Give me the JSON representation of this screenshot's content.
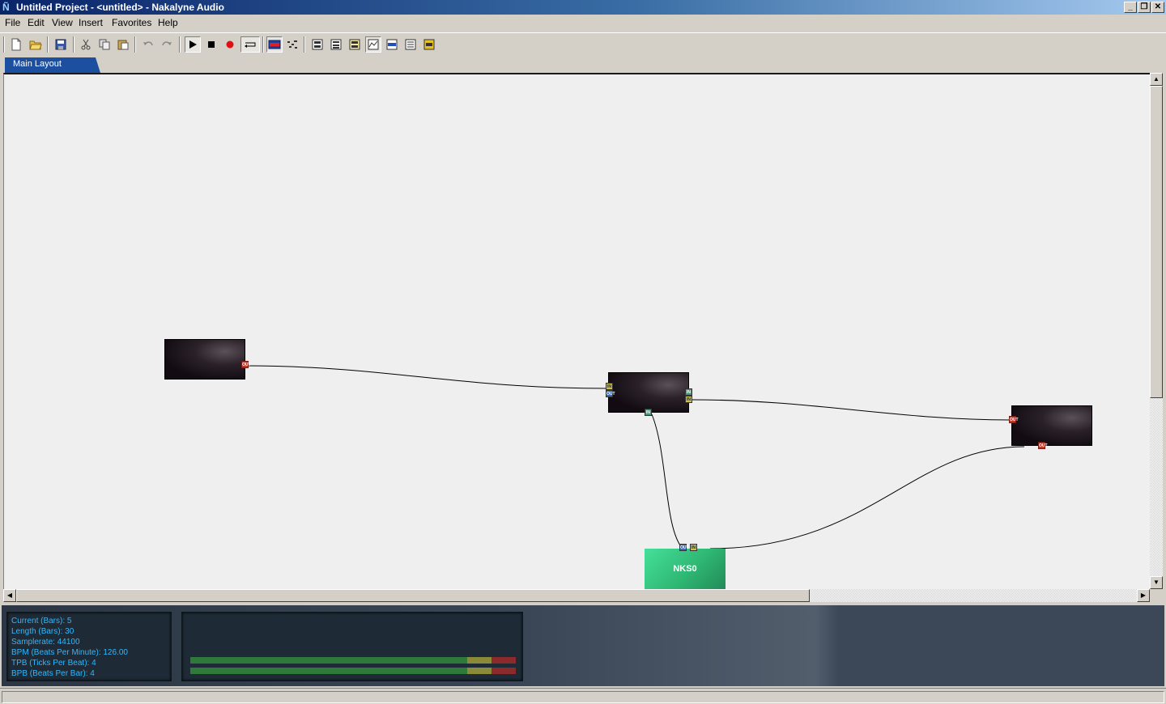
{
  "window": {
    "title": "Untitled Project - <untitled> - Nakalyne Audio",
    "app_icon": "Ñ",
    "controls": {
      "minimize": "_",
      "restore": "❐",
      "close": "✕"
    }
  },
  "menu": [
    "File",
    "Edit",
    "View",
    "Insert",
    "Favorites",
    "Help"
  ],
  "toolbar": {
    "buttons": [
      "new-file-icon",
      "open-folder-icon",
      "save-icon",
      "cut-icon",
      "copy-icon",
      "paste-icon",
      "undo-icon",
      "redo-icon",
      "play-icon",
      "stop-icon",
      "record-icon",
      "loop-icon",
      "mixer-icon",
      "piano-roll-icon",
      "view-1-icon",
      "view-2-icon",
      "view-3-icon",
      "view-4-icon",
      "view-5-icon",
      "view-6-icon",
      "view-7-icon"
    ]
  },
  "tabs": [
    {
      "label": "Main Layout",
      "active": true
    }
  ],
  "layout": {
    "nodes": [
      {
        "id": "node-1",
        "label": ""
      },
      {
        "id": "node-2",
        "label": ""
      },
      {
        "id": "node-3",
        "label": ""
      },
      {
        "id": "nks0",
        "label": "NKS0"
      }
    ],
    "port_labels": {
      "out": "OUT",
      "in": "IN"
    }
  },
  "scrollbar": {
    "up": "▲",
    "down": "▼",
    "left": "◀",
    "right": "▶"
  },
  "info": {
    "current": "Current (Bars): 5",
    "length": "Length (Bars): 30",
    "samplerate": "Samplerate: 44100",
    "bpm": "BPM (Beats Per Minute): 126.00",
    "tpb": "TPB (Ticks Per Beat): 4",
    "bpb": "BPB (Beats Per Bar): 4"
  },
  "colors": {
    "info_text": "#2eb8ff",
    "tab_active": "#1c4fa0",
    "node_green": "#2fb874"
  },
  "meters": [
    {
      "channel": "left",
      "level": 0.93
    },
    {
      "channel": "right",
      "level": 0.93
    }
  ]
}
